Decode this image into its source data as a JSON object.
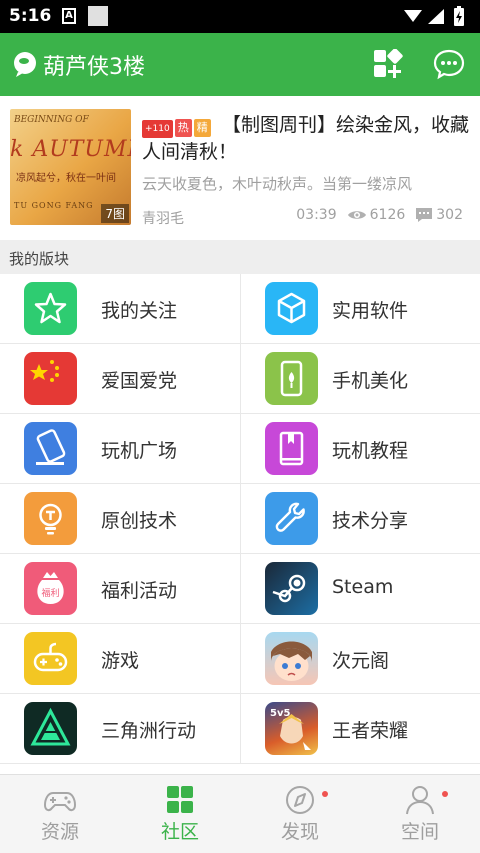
{
  "status_bar": {
    "time": "5:16",
    "notif_glyph": "A"
  },
  "app_bar": {
    "title": "葫芦侠3楼"
  },
  "featured": {
    "badge_num": "+110",
    "badge_hot": "热",
    "badge_essence": "精",
    "title": "【制图周刊】绘染金风，收藏人间清秋！",
    "description": "云天收夏色，木叶动秋声。当第一缕凉风",
    "author": "青羽毛",
    "time": "03:39",
    "views": "6126",
    "comments": "302",
    "image_count": "7图",
    "thumb_text": {
      "sub": "BEGINNING OF",
      "title": "k AUTUMN",
      "line": "凉风起兮，秋在一叶间",
      "foot": "TU GONG FANG"
    }
  },
  "section": {
    "title": "我的版块"
  },
  "boards": [
    {
      "label": "我的关注",
      "icon": "star-icon",
      "color": "#2ecc71"
    },
    {
      "label": "实用软件",
      "icon": "cube-icon",
      "color": "#29b6f6"
    },
    {
      "label": "爱国爱党",
      "icon": "china-flag-icon",
      "color": "#e53935"
    },
    {
      "label": "手机美化",
      "icon": "phone-beautify-icon",
      "color": "#8bc34a"
    },
    {
      "label": "玩机广场",
      "icon": "phone-tilt-icon",
      "color": "#3f7fe0"
    },
    {
      "label": "玩机教程",
      "icon": "tutorial-book-icon",
      "color": "#c748d8"
    },
    {
      "label": "原创技术",
      "icon": "bulb-icon",
      "color": "#f39c3c"
    },
    {
      "label": "技术分享",
      "icon": "wrench-icon",
      "color": "#3d9be9"
    },
    {
      "label": "福利活动",
      "icon": "gift-bag-icon",
      "color": "#f05b79"
    },
    {
      "label": "Steam",
      "icon": "steam-icon",
      "color": "#1b2838"
    },
    {
      "label": "游戏",
      "icon": "gamepad-icon",
      "color": "#f3c623"
    },
    {
      "label": "次元阁",
      "icon": "anime-avatar-icon",
      "color": "#f6b7a8"
    },
    {
      "label": "三角洲行动",
      "icon": "delta-force-icon",
      "color": "#0f2a24"
    },
    {
      "label": "王者荣耀",
      "icon": "honor-of-kings-icon",
      "color": "#d95d2a"
    }
  ],
  "bottom_nav": [
    {
      "label": "资源",
      "icon": "gamepad-outline-icon",
      "active": false,
      "dot": false
    },
    {
      "label": "社区",
      "icon": "community-grid-icon",
      "active": true,
      "dot": false
    },
    {
      "label": "发现",
      "icon": "compass-icon",
      "active": false,
      "dot": true
    },
    {
      "label": "空间",
      "icon": "person-icon",
      "active": false,
      "dot": true
    }
  ],
  "colors": {
    "brand": "#3bb34a",
    "accent_red": "#ef5350"
  }
}
